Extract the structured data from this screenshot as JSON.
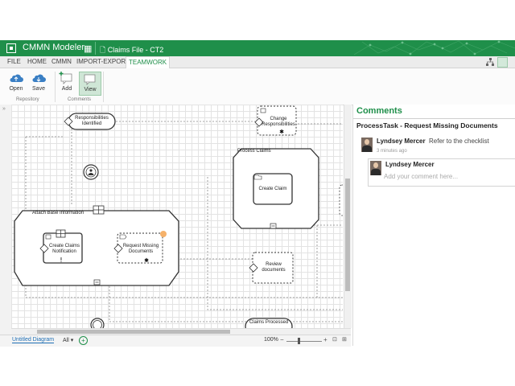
{
  "app": {
    "title": "CMMN Modeler",
    "file_name": "Claims File - CT2"
  },
  "menu": {
    "items": [
      "FILE",
      "HOME",
      "CMMN",
      "IMPORT-EXPORT",
      "TEAMWORK"
    ],
    "active": "TEAMWORK"
  },
  "ribbon": {
    "open_label": "Open",
    "save_label": "Save",
    "add_label": "Add",
    "view_label": "View",
    "group_repository": "Repository",
    "group_comments": "Comments"
  },
  "diagram": {
    "responsibilities": "Responsibilities Identified",
    "change_responsibilities": "Change Responsibilities",
    "process_claims": "Process Claims",
    "create_claim": "Create Claim",
    "attach_base_info": "Attach Base Information",
    "create_claims_notification": "Create Claims Notification",
    "request_missing_documents": "Request Missing Documents",
    "review_documents": "Review documents",
    "claims_processed": "Claims Processed"
  },
  "status": {
    "tab": "Untitled Diagram",
    "filter": "All",
    "zoom": "100%"
  },
  "comments": {
    "title": "Comments",
    "task": "ProcessTask - Request Missing Documents",
    "author": "Lyndsey Mercer",
    "text": "Refer to the checklist",
    "time": "3 minutes ago",
    "reply_author": "Lyndsey Mercer",
    "placeholder": "Add your comment here..."
  },
  "colors": {
    "brand": "#1f8f4a",
    "title_bar": "#1f8f4a"
  },
  "icons": [
    "folder-icon",
    "grid-icon",
    "file-icon",
    "cloud-open-icon",
    "cloud-save-icon",
    "comment-add-icon",
    "comment-view-icon",
    "hierarchy-icon",
    "settings-icon"
  ]
}
